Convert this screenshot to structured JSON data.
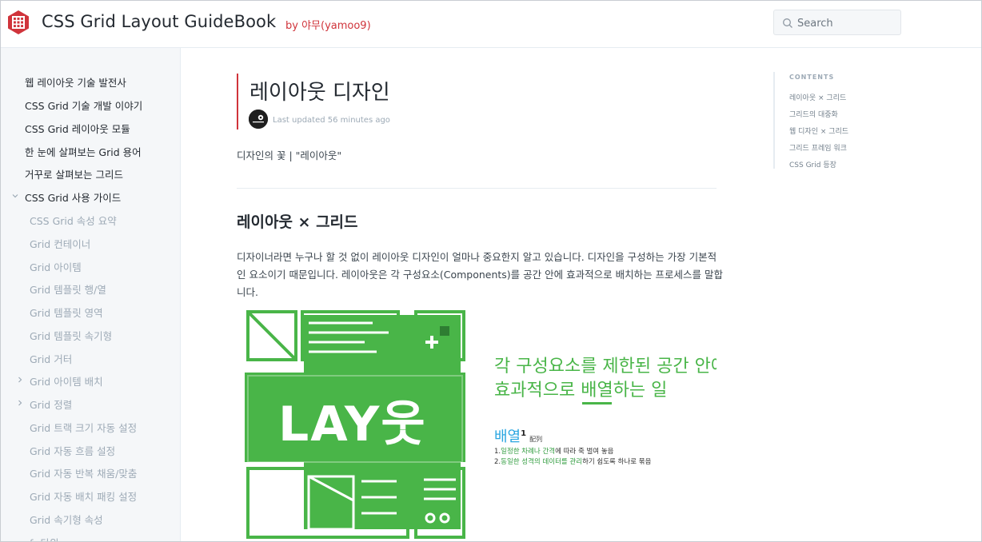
{
  "header": {
    "title": "CSS Grid Layout GuideBook",
    "byline": "by 야무(yamoo9)",
    "search_placeholder": "Search",
    "brand_color": "#d0343b"
  },
  "sidebar": {
    "items": [
      {
        "label": "웹 레이아웃 기술 발전사",
        "level": 0
      },
      {
        "label": "CSS Grid 기술 개발 이야기",
        "level": 0
      },
      {
        "label": "CSS Grid 레이아웃 모듈",
        "level": 0
      },
      {
        "label": "한 눈에 살펴보는 Grid 용어",
        "level": 0
      },
      {
        "label": "거꾸로 살펴보는 그리드",
        "level": 0
      },
      {
        "label": "CSS Grid 사용 가이드",
        "level": 0,
        "expanded": true
      },
      {
        "label": "CSS Grid 속성 요약",
        "level": 1
      },
      {
        "label": "Grid 컨테이너",
        "level": 1
      },
      {
        "label": "Grid 아이템",
        "level": 1
      },
      {
        "label": "Grid 템플릿 행/열",
        "level": 1
      },
      {
        "label": "Grid 템플릿 영역",
        "level": 1
      },
      {
        "label": "Grid 템플릿 속기형",
        "level": 1
      },
      {
        "label": "Grid 거터",
        "level": 1
      },
      {
        "label": "Grid 아이템 배치",
        "level": 1,
        "collapsed": true
      },
      {
        "label": "Grid 정렬",
        "level": 1,
        "collapsed": true
      },
      {
        "label": "Grid 트랙 크기 자동 설정",
        "level": 1
      },
      {
        "label": "Grid 자동 흐름 설정",
        "level": 1
      },
      {
        "label": "Grid 자동 반복 채움/맞춤",
        "level": 1
      },
      {
        "label": "Grid 자동 배치 패킹 설정",
        "level": 1
      },
      {
        "label": "Grid 속기형 속성",
        "level": 1
      },
      {
        "label": "fr 단위",
        "level": 1
      }
    ]
  },
  "main": {
    "title": "레이아웃 디자인",
    "last_updated": "Last updated 56 minutes ago",
    "description": "디자인의 꽃 | \"레이아웃\"",
    "section_heading": "레이아웃 × 그리드",
    "paragraph": "디자이너라면 누구나 할 것 없이 레이아웃 디자인이 얼마나 중요한지 알고 있습니다. 디자인을 구성하는 가장 기본적인 요소이기 때문입니다. 레이아웃은 각 구성요소(Components)를 공간 안에 효과적으로 배치하는 프로세스를 말합니다.",
    "figure": {
      "headline_line1": "각 구성요소를 제한된 공간 안에",
      "headline_line2_pre": "효과적으로 ",
      "headline_line2_em": "배열",
      "headline_line2_post": "하는 일",
      "logo_text": "LAY웃",
      "term": "배열",
      "term_sup": "1",
      "term_hanja": "配列",
      "def1_pre": "1.",
      "def1_hl": "일정한 차례나 간격",
      "def1_post": "에 따라 죽 벌여 놓음",
      "def2_pre": "2.",
      "def2_hl": "동일한 성격의 데이터를 관리",
      "def2_post": "하기 쉽도록 하나로 묶음",
      "green": "#49b548",
      "term_color": "#2aa6e0"
    }
  },
  "toc": {
    "heading": "CONTENTS",
    "items": [
      "레이아웃 × 그리드",
      "그리드의 대중화",
      "웹 디자인 × 그리드",
      "그리드 프레임 워크",
      "CSS Grid 등장"
    ]
  }
}
